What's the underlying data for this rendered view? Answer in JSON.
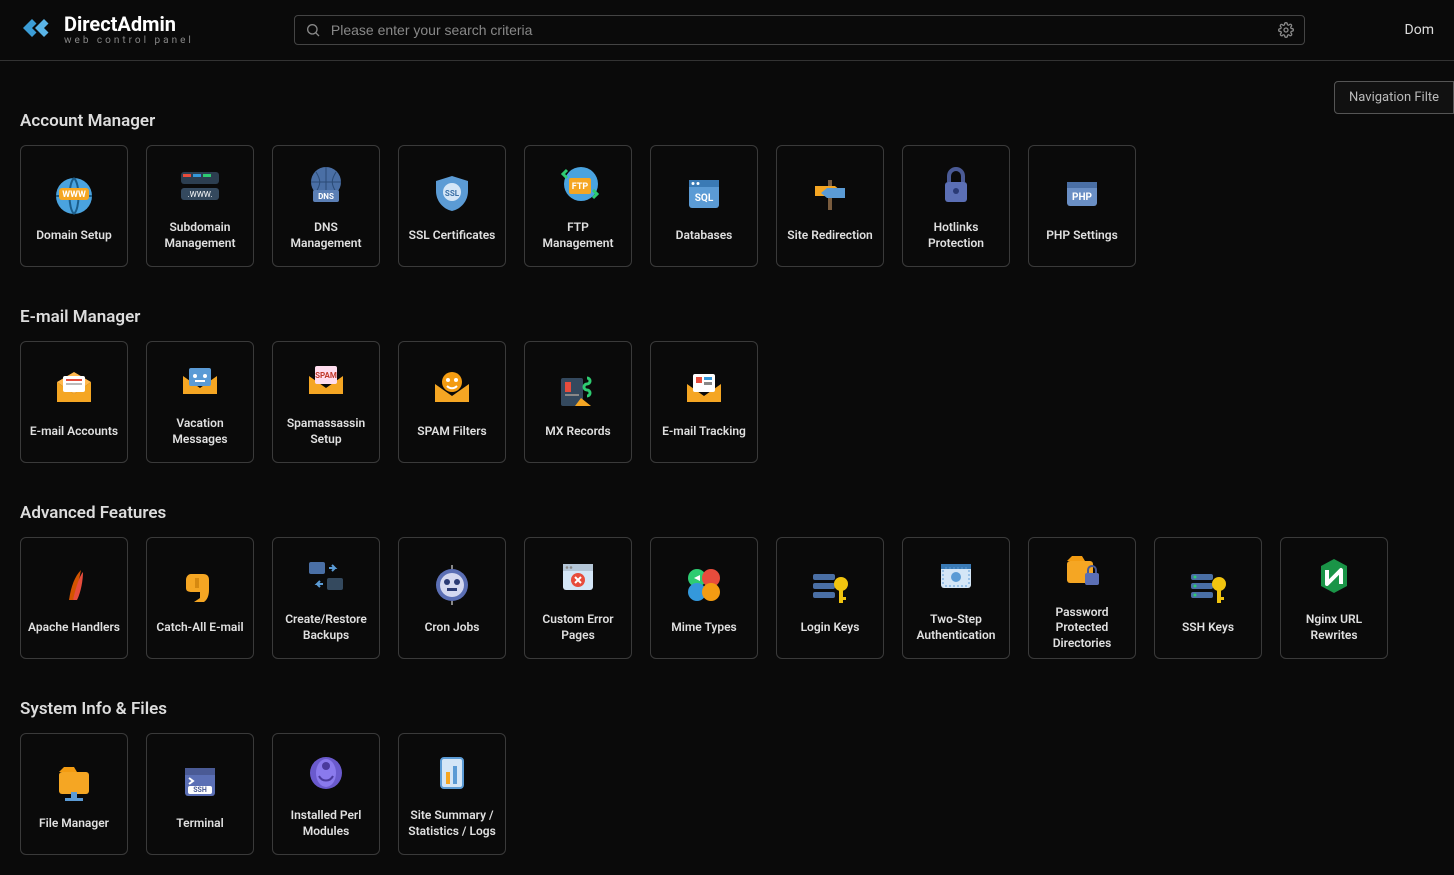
{
  "brand": {
    "title": "DirectAdmin",
    "subtitle": "web control panel"
  },
  "search": {
    "placeholder": "Please enter your search criteria"
  },
  "header": {
    "right": "Dom"
  },
  "nav_filter": "Navigation Filte",
  "sections": [
    {
      "title": "Account Manager",
      "items": [
        {
          "label": "Domain Setup",
          "icon": "domain-setup-icon"
        },
        {
          "label": "Subdomain Management",
          "icon": "subdomain-icon"
        },
        {
          "label": "DNS Management",
          "icon": "dns-icon"
        },
        {
          "label": "SSL Certificates",
          "icon": "ssl-icon"
        },
        {
          "label": "FTP Management",
          "icon": "ftp-icon"
        },
        {
          "label": "Databases",
          "icon": "sql-icon"
        },
        {
          "label": "Site Redirection",
          "icon": "redirect-icon"
        },
        {
          "label": "Hotlinks Protection",
          "icon": "lock-icon"
        },
        {
          "label": "PHP Settings",
          "icon": "php-icon"
        }
      ]
    },
    {
      "title": "E-mail Manager",
      "items": [
        {
          "label": "E-mail Accounts",
          "icon": "email-icon"
        },
        {
          "label": "Vacation Messages",
          "icon": "vacation-icon"
        },
        {
          "label": "Spamassassin Setup",
          "icon": "spam-setup-icon"
        },
        {
          "label": "SPAM Filters",
          "icon": "spam-filter-icon"
        },
        {
          "label": "MX Records",
          "icon": "mx-icon"
        },
        {
          "label": "E-mail Tracking",
          "icon": "tracking-icon"
        }
      ]
    },
    {
      "title": "Advanced Features",
      "items": [
        {
          "label": "Apache Handlers",
          "icon": "apache-icon"
        },
        {
          "label": "Catch-All E-mail",
          "icon": "catchall-icon"
        },
        {
          "label": "Create/Restore Backups",
          "icon": "backup-icon"
        },
        {
          "label": "Cron Jobs",
          "icon": "cron-icon"
        },
        {
          "label": "Custom Error Pages",
          "icon": "error-pages-icon"
        },
        {
          "label": "Mime Types",
          "icon": "mime-icon"
        },
        {
          "label": "Login Keys",
          "icon": "login-keys-icon"
        },
        {
          "label": "Two-Step Authentication",
          "icon": "twofa-icon"
        },
        {
          "label": "Password Protected Directories",
          "icon": "passdir-icon"
        },
        {
          "label": "SSH Keys",
          "icon": "ssh-keys-icon"
        },
        {
          "label": "Nginx URL Rewrites",
          "icon": "nginx-icon"
        }
      ]
    },
    {
      "title": "System Info & Files",
      "items": [
        {
          "label": "File Manager",
          "icon": "file-manager-icon"
        },
        {
          "label": "Terminal",
          "icon": "terminal-icon"
        },
        {
          "label": "Installed Perl Modules",
          "icon": "perl-icon"
        },
        {
          "label": "Site Summary / Statistics / Logs",
          "icon": "stats-icon"
        }
      ]
    }
  ]
}
